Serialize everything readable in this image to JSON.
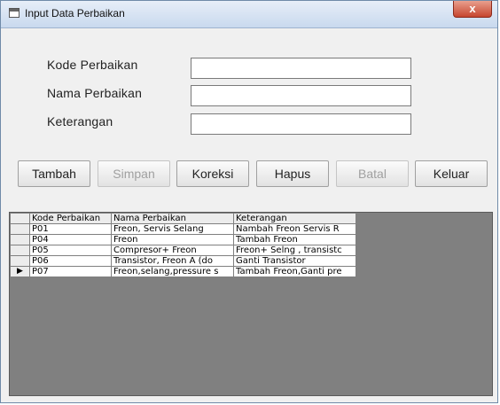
{
  "window": {
    "title": "Input Data Perbaikan",
    "close_glyph": "x"
  },
  "form": {
    "kode_label": "Kode Perbaikan",
    "nama_label": "Nama Perbaikan",
    "keterangan_label": "Keterangan",
    "kode_value": "",
    "nama_value": "",
    "keterangan_value": ""
  },
  "buttons": {
    "tambah": "Tambah",
    "simpan": "Simpan",
    "koreksi": "Koreksi",
    "hapus": "Hapus",
    "batal": "Batal",
    "keluar": "Keluar"
  },
  "grid": {
    "columns": [
      "Kode Perbaikan",
      "Nama Perbaikan",
      "Keterangan"
    ],
    "rows": [
      {
        "kode": "P01",
        "nama": "Freon, Servis Selang",
        "ket": "Nambah Freon Servis R",
        "current": false
      },
      {
        "kode": "P04",
        "nama": "Freon",
        "ket": "Tambah Freon",
        "current": false
      },
      {
        "kode": "P05",
        "nama": "Compresor+ Freon",
        "ket": "Freon+ Selng , transistc",
        "current": false
      },
      {
        "kode": "P06",
        "nama": "Transistor, Freon A (do",
        "ket": "Ganti Transistor",
        "current": false
      },
      {
        "kode": "P07",
        "nama": "Freon,selang,pressure s",
        "ket": "Tambah Freon,Ganti pre",
        "current": true
      }
    ],
    "current_row_glyph": "▶"
  }
}
